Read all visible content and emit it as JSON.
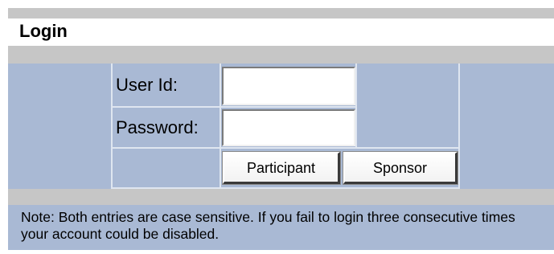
{
  "login": {
    "title": "Login",
    "user_id_label": "User Id:",
    "user_id_value": "",
    "password_label": "Password:",
    "password_value": "",
    "participant_button": "Participant",
    "sponsor_button": "Sponsor",
    "note": "Note: Both entries are case sensitive. If you fail to login three consecutive times your account could be disabled."
  },
  "colors": {
    "panel_blue": "#a9b9d4",
    "band_gray": "#c6c6c6"
  }
}
